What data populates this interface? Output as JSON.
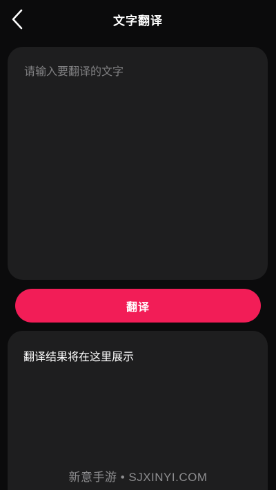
{
  "header": {
    "title": "文字翻译",
    "back_icon": "chevron-left-icon"
  },
  "input": {
    "placeholder": "请输入要翻译的文字",
    "value": ""
  },
  "action": {
    "translate_label": "翻译"
  },
  "result": {
    "text": "翻译结果将在这里展示"
  },
  "watermark": {
    "text": "新意手游 • SJXINYI.COM"
  },
  "colors": {
    "background": "#0b0b0c",
    "card": "#1e1e1f",
    "accent": "#f21d57",
    "placeholder": "#808082"
  }
}
